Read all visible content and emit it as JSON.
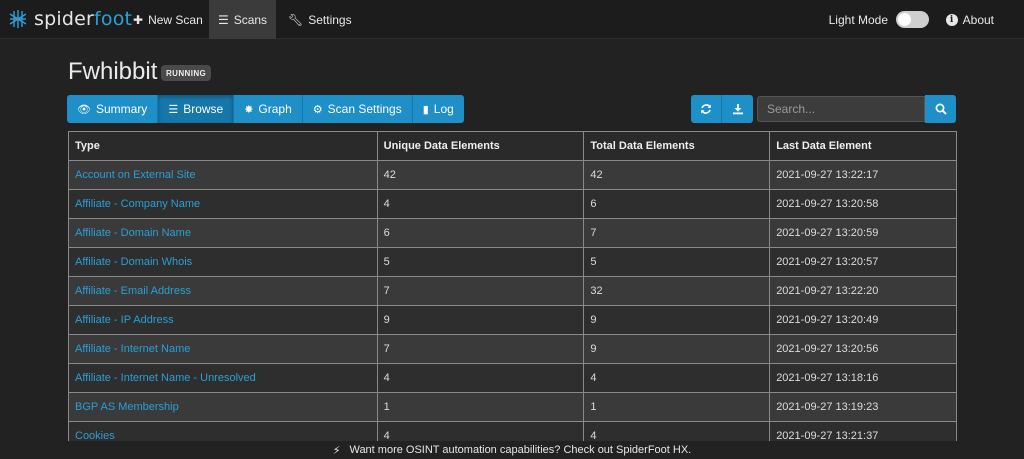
{
  "navbar": {
    "brand_spider": "spider",
    "brand_foot": "foot",
    "items": [
      {
        "label": "New Scan",
        "icon": "plus-icon"
      },
      {
        "label": "Scans",
        "icon": "list-icon"
      },
      {
        "label": "Settings",
        "icon": "wrench-icon"
      }
    ],
    "light_mode_label": "Light Mode",
    "about_label": "About"
  },
  "scan": {
    "title": "Fwhibbit",
    "status": "RUNNING"
  },
  "tabs": [
    {
      "label": "Summary",
      "icon": "eye-icon"
    },
    {
      "label": "Browse",
      "icon": "list-icon"
    },
    {
      "label": "Graph",
      "icon": "graph-icon"
    },
    {
      "label": "Scan Settings",
      "icon": "gear-icon"
    },
    {
      "label": "Log",
      "icon": "book-icon"
    }
  ],
  "search": {
    "placeholder": "Search..."
  },
  "table": {
    "headers": [
      "Type",
      "Unique Data Elements",
      "Total Data Elements",
      "Last Data Element"
    ],
    "rows": [
      [
        "Account on External Site",
        "42",
        "42",
        "2021-09-27 13:22:17"
      ],
      [
        "Affiliate - Company Name",
        "4",
        "6",
        "2021-09-27 13:20:58"
      ],
      [
        "Affiliate - Domain Name",
        "6",
        "7",
        "2021-09-27 13:20:59"
      ],
      [
        "Affiliate - Domain Whois",
        "5",
        "5",
        "2021-09-27 13:20:57"
      ],
      [
        "Affiliate - Email Address",
        "7",
        "32",
        "2021-09-27 13:22:20"
      ],
      [
        "Affiliate - IP Address",
        "9",
        "9",
        "2021-09-27 13:20:49"
      ],
      [
        "Affiliate - Internet Name",
        "7",
        "9",
        "2021-09-27 13:20:56"
      ],
      [
        "Affiliate - Internet Name - Unresolved",
        "4",
        "4",
        "2021-09-27 13:18:16"
      ],
      [
        "BGP AS Membership",
        "1",
        "1",
        "2021-09-27 13:19:23"
      ],
      [
        "Cookies",
        "4",
        "4",
        "2021-09-27 13:21:37"
      ]
    ]
  },
  "footer": {
    "text": "Want more OSINT automation capabilities? Check out SpiderFoot HX."
  },
  "colors": {
    "accent": "#1e8fc7",
    "link": "#2a9fd6",
    "background": "#222222"
  }
}
